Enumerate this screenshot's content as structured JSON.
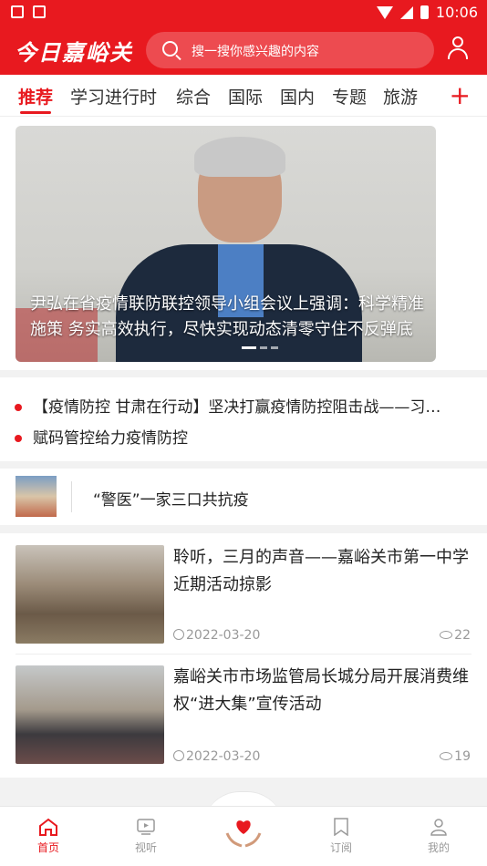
{
  "status": {
    "time": "10:06"
  },
  "header": {
    "logo": "今日嘉峪关",
    "search_placeholder": "搜一搜你感兴趣的内容"
  },
  "tabs": [
    "推荐",
    "学习进行时",
    "综合",
    "国际",
    "国内",
    "专题",
    "旅游"
  ],
  "banner": {
    "caption_line1": "尹弘在省疫情联防联控领导小组会议上强调：科学精准",
    "caption_line2": "施策 务实高效执行，尽快实现动态清零守住不反弹底"
  },
  "headlines": [
    "【疫情防控 甘肃在行动】坚决打赢疫情防控阻击战——习…",
    "赋码管控给力疫情防控"
  ],
  "small_item": {
    "title": "“警医”一家三口共抗疫"
  },
  "news": [
    {
      "title": "聆听，三月的声音——嘉峪关市第一中学近期活动掠影",
      "date": "2022-03-20",
      "views": "22"
    },
    {
      "title": "嘉峪关市市场监管局长城分局开展消费维权“进大集”宣传活动",
      "date": "2022-03-20",
      "views": "19"
    }
  ],
  "nav": {
    "home": "首页",
    "video": "视听",
    "subscribe": "订阅",
    "mine": "我的"
  },
  "colors": {
    "accent": "#e8191f"
  }
}
